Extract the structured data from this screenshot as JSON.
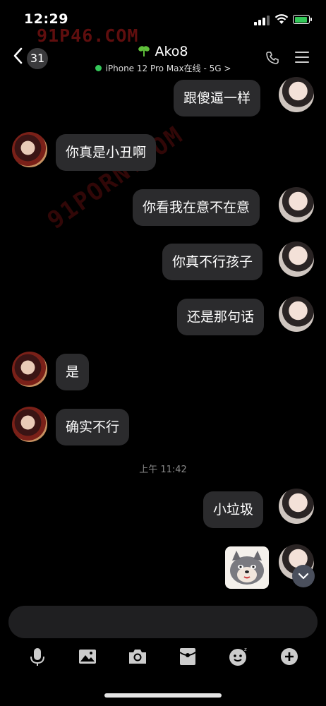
{
  "status": {
    "time": "12:29"
  },
  "watermark": {
    "text": "91P46.COM",
    "diagonal_text": "91PORN.COM"
  },
  "header": {
    "back_count": "31",
    "contact_name": "Ako8",
    "device_status": "iPhone 12 Pro Max在线 - 5G",
    "chevron": ">"
  },
  "messages": [
    {
      "side": "me",
      "text": "跟傻逼一样"
    },
    {
      "side": "other",
      "text": "你真是小丑啊"
    },
    {
      "side": "me",
      "text": "你看我在意不在意"
    },
    {
      "side": "me",
      "text": "你真不行孩子"
    },
    {
      "side": "me",
      "text": "还是那句话"
    },
    {
      "side": "other",
      "text": "是"
    },
    {
      "side": "other",
      "text": "确实不行"
    },
    {
      "side": "me",
      "text": "小垃圾"
    },
    {
      "side": "me",
      "type": "sticker",
      "icon": "dog-sticker"
    }
  ],
  "timestamp": "上午 11:42",
  "toolbar": {
    "icons": [
      "microphone-icon",
      "image-icon",
      "camera-icon",
      "red-packet-icon",
      "emoji-icon",
      "plus-icon"
    ]
  },
  "colors": {
    "background": "#000000",
    "bubble": "#2b2b2d",
    "online": "#34c759",
    "watermark": "#6a1010"
  }
}
